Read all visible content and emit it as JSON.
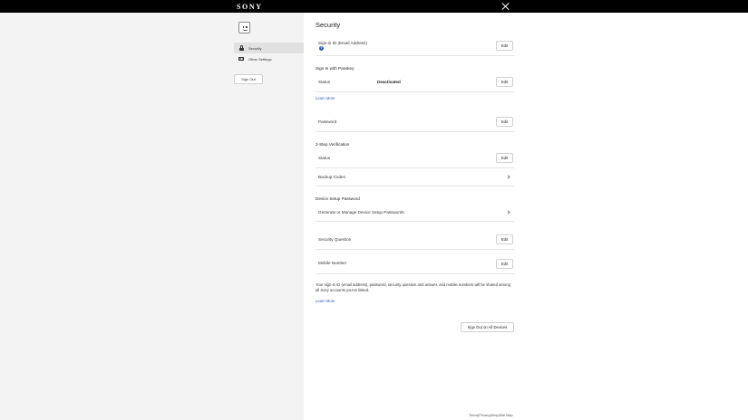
{
  "header": {
    "brand": "SONY"
  },
  "sidebar": {
    "items": [
      {
        "label": "Security",
        "icon": "lock-icon",
        "active": true
      },
      {
        "label": "Other Settings",
        "icon": "settings-icon",
        "active": false
      }
    ],
    "sign_out_label": "Sign Out"
  },
  "main": {
    "title": "Security",
    "sign_in_id": {
      "label": "Sign-in ID (Email Address)",
      "edit_label": "Edit"
    },
    "passkey": {
      "heading": "Sign In with Passkey",
      "status_label": "Status",
      "status_value": "Deactivated",
      "edit_label": "Edit",
      "learn_more": "Learn More"
    },
    "password": {
      "label": "Password",
      "edit_label": "Edit"
    },
    "two_step": {
      "heading": "2-Step Verification",
      "status_label": "Status",
      "edit_label": "Edit",
      "backup_codes_label": "Backup Codes"
    },
    "device_setup": {
      "heading": "Device Setup Password",
      "generate_label": "Generate or Manage Device Setup Passwords"
    },
    "security_question": {
      "label": "Security Question",
      "edit_label": "Edit"
    },
    "mobile_number": {
      "label": "Mobile Number",
      "edit_label": "Edit"
    },
    "info_text": "Your sign-in ID (email address), password, security question and answer, and mobile numbers will be shared among all Sony accounts you've linked.",
    "info_learn_more": "Learn More",
    "sign_out_all_label": "Sign Out on All Devices"
  },
  "footer": {
    "links": [
      "Terms",
      "Privacy",
      "Help",
      "Site Map"
    ],
    "separator": "|"
  }
}
